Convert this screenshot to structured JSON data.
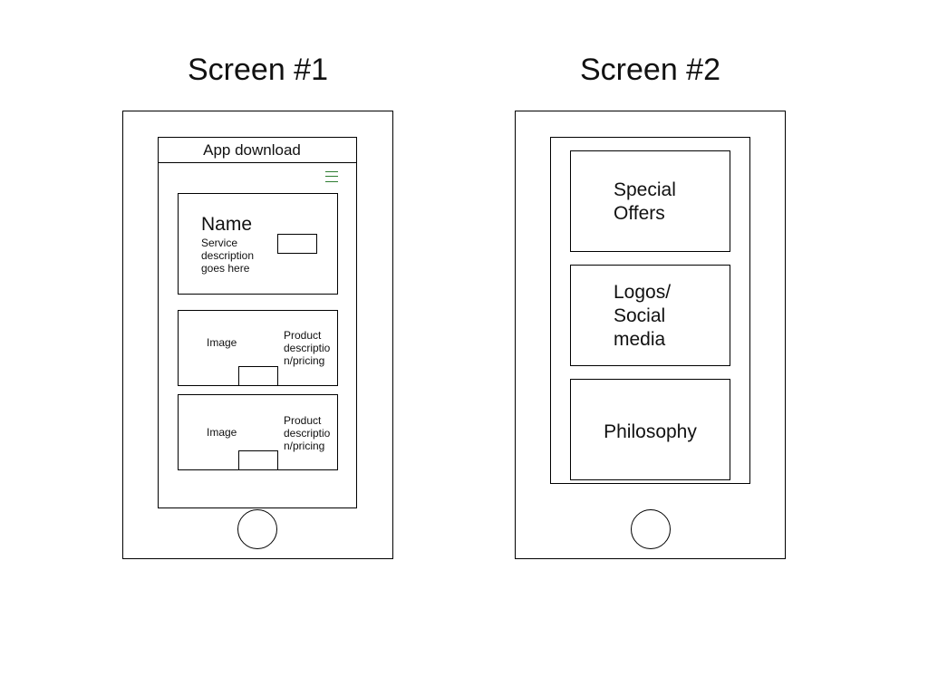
{
  "colors": {
    "menu_icon": "#2e7d32"
  },
  "screen1": {
    "title": "Screen #1",
    "header_title": "App download",
    "menu_icon": "hamburger-menu-icon",
    "service_card": {
      "name": "Name",
      "description": [
        "Service",
        "description",
        "goes here"
      ]
    },
    "product_cards": [
      {
        "image_label": "Image",
        "description": [
          "Product",
          "descriptio",
          "n/pricing"
        ]
      },
      {
        "image_label": "Image",
        "description": [
          "Product",
          "descriptio",
          "n/pricing"
        ]
      }
    ]
  },
  "screen2": {
    "title": "Screen #2",
    "tiles": [
      {
        "lines": [
          "Special",
          "Offers"
        ]
      },
      {
        "lines": [
          "Logos/",
          "Social",
          "media"
        ]
      },
      {
        "lines": [
          "Philosophy"
        ]
      }
    ]
  }
}
